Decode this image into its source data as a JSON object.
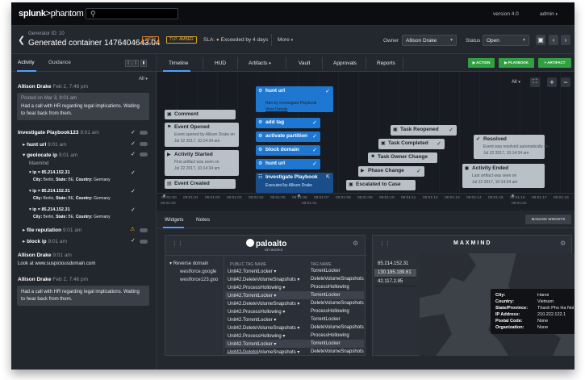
{
  "topbar": {
    "brand_main": "splunk",
    "brand_sep": ">",
    "brand_sub": "phantom",
    "search_icon": "search-icon",
    "version": "version 4.0",
    "user": "admin"
  },
  "header": {
    "generator_id": "Generator ID: 10",
    "container_name": "Generated container 1476404643.04",
    "severity": "HIGH",
    "tlp": "TLP: AMBER",
    "sla_label": "SLA:",
    "sla_value": "Exceeded by 4 days",
    "more": "More",
    "owner_label": "Owner",
    "owner_value": "Allison Drake",
    "status_label": "Status",
    "status_value": "Open"
  },
  "left": {
    "tabs": [
      "Activity",
      "Guidance"
    ],
    "filter": "All",
    "entries": {
      "e1_user": "Allison Drake",
      "e1_time": "Feb 2, 7:46 pm",
      "e1_posted": "Posted on Mar 3, 9:01 am",
      "e1_line1": "Had a call with HR regarding legal implications. Waiting",
      "e1_line2": "to hear back from them.",
      "pb_title": "Investigate Playbook123",
      "pb_time": "9:01 am",
      "hunt": "hunt url",
      "hunt_time": "9:01 am",
      "geo": "geolocate ip",
      "geo_time": "9:01 am",
      "maxmind": "Maxmind",
      "ip_line": "ip = 85.214.152.31",
      "city_lbl": "City:",
      "city": "Berlin,",
      "state_lbl": "State:",
      "state": "BE,",
      "country_lbl": "Country:",
      "country": "Germany",
      "filerep": "file reputation",
      "filerep_time": "9:01 am",
      "blockip": "block ip",
      "blockip_time": "9:01 am",
      "e2_user": "Allison Drake",
      "e2_time": "9:01 am",
      "e2_text": "Look at www.suspiciousdomain.com",
      "e3_user": "Allison Drake",
      "e3_time": "Feb 2, 7:46 pm",
      "e3_line1": "Had a call with HR regarding legal implications. Waiting",
      "e3_line2": "to hear back from them."
    }
  },
  "tabs": [
    "Timeline",
    "HUD",
    "Artifacts",
    "Vault",
    "Approvals",
    "Reports"
  ],
  "actions": {
    "action": "ACTION",
    "playbook": "PLAYBOOK",
    "artifact": "ARTIFACT"
  },
  "timeline": {
    "filter": "All",
    "events": {
      "comment": "Comment",
      "opened": "Event Opened",
      "opened_sub1": "Event opened by Allison Drake on",
      "opened_sub2": "Jul 22 2017, 10:14:34 am",
      "started": "Activity Started",
      "started_sub1": "First artifact was seen on",
      "started_sub2": "Jul 22 2017, 10:14:34 am",
      "created": "Event Created",
      "hunt": "hunt url",
      "hunt_sub1": "Ran by Investigate Playbook",
      "hunt_sub2": "View Details",
      "addtag": "add tag",
      "activate": "activate partition",
      "block": "block domain",
      "hunt2": "hunt url",
      "invpb": "Investigate Playbook",
      "invpb_sub": "Executed by Allison Drake",
      "reopened": "Task Reopened",
      "completed": "Task Completed",
      "owner": "Task Owner Change",
      "phase": "Phase Change",
      "escalated": "Escalated to Case",
      "resolved": "Resolved",
      "resolved_sub1": "Event was resolved automatically on",
      "resolved_sub2": "Jul 22 2017, 10:14:34 am",
      "ended": "Activity Ended",
      "ended_sub1": "Last artifact was seen on",
      "ended_sub2": "Jul 22 2017, 10:14:34 am"
    },
    "ticks": [
      "09:01:00",
      "09:01:01",
      "09:01:02",
      "09:01:03",
      "09:01:04",
      "09:01:05",
      "09:01:06",
      "09:01:07",
      "09:01:08",
      "09:01:09",
      "09:01:10",
      "09:01:11",
      "09:01:12",
      "09:01:13",
      "09:01:14",
      "09:01:15",
      "09:01:16",
      "09:01:17",
      "09:01:18"
    ],
    "tick_major_left": "09:01:00",
    "tick_major_mid": "09:01:01",
    "tick_major_right": "09:01:02"
  },
  "bottom": {
    "tabs": [
      "Widgets",
      "Notes"
    ],
    "manage": "MANAGE WIDGETS",
    "paloalto": {
      "logo": "paloalto",
      "logo_sub": "NETWORKS",
      "tree_root": "Reverse domain",
      "tree_a": "westforce.google",
      "tree_b": "westforce123.goo",
      "col1": "PUBLIC TAG NAME",
      "col2": "TAG NAME",
      "rows": [
        [
          "Unit42.TorrentLocker",
          "TorrentLocker"
        ],
        [
          "Unit42.DeleteVolumeSnapshots",
          "DeleteVolumeSnapshots"
        ],
        [
          "Unit42.ProcessHollowing",
          "ProcessHollowing"
        ],
        [
          "Unit42.TorrentLocker",
          "TorrentLocker"
        ],
        [
          "Unit42.DeleteVolumeSnapshots",
          "DeleteVolumeSnapshots"
        ],
        [
          "Unit42.ProcessHollowing",
          "ProcessHollowing"
        ],
        [
          "Unit42.TorrentLocker",
          "TorrentLocker"
        ],
        [
          "Unit42.DeleteVolumeSnapshots",
          "DeleteVolumeSnapshots"
        ],
        [
          "Unit42.ProcessHollowing",
          "ProcessHollowing"
        ],
        [
          "Unit42.TorrentLocker",
          "TorrentLocker"
        ],
        [
          "Unit42.DeleteVolumeSnapshots",
          "DeleteVolumeSnapshots"
        ]
      ]
    },
    "maxmind": {
      "logo": "MAXMIND",
      "ips": [
        "85.214.152.31",
        "130.185.189.61",
        "42.117.2.85"
      ],
      "popup": {
        "city_k": "City:",
        "city_v": "Hanoi",
        "country_k": "Country:",
        "country_v": "Vietnam",
        "state_k": "State/Province:",
        "state_v": "Thanh Pho Ha Noi",
        "ip_k": "IP Address:",
        "ip_v": "210.222.122.1",
        "postal_k": "Postal Code:",
        "postal_v": "None",
        "org_k": "Organization:",
        "org_v": "None"
      }
    }
  }
}
